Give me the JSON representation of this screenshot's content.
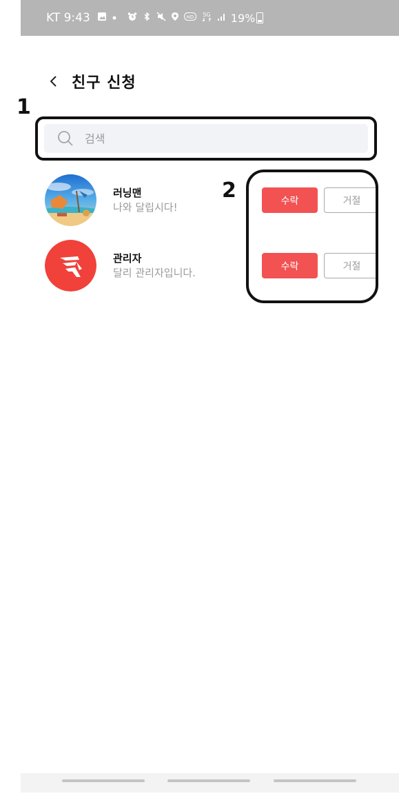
{
  "status_bar": {
    "time": "KT 9:43",
    "battery": "19%",
    "icons": [
      "gallery-icon",
      "dot-icon",
      "alarm-icon",
      "bluetooth-icon",
      "mute-icon",
      "location-icon",
      "hd-icon",
      "5g-icon",
      "signal-icon",
      "battery-icon"
    ]
  },
  "header": {
    "title": "친구 신청"
  },
  "annotations": {
    "label1": "1",
    "label2": "2"
  },
  "search": {
    "placeholder": "검색",
    "value": ""
  },
  "friends": [
    {
      "name": "러닝맨",
      "message": "나와 달립시다!",
      "accept_label": "수락",
      "reject_label": "거절"
    },
    {
      "name": "관리자",
      "message": "달리 관리자입니다.",
      "accept_label": "수락",
      "reject_label": "거절"
    }
  ],
  "colors": {
    "accent": "#f25252",
    "status_bar": "#b5b5b5",
    "search_bg": "#f2f3f6"
  }
}
